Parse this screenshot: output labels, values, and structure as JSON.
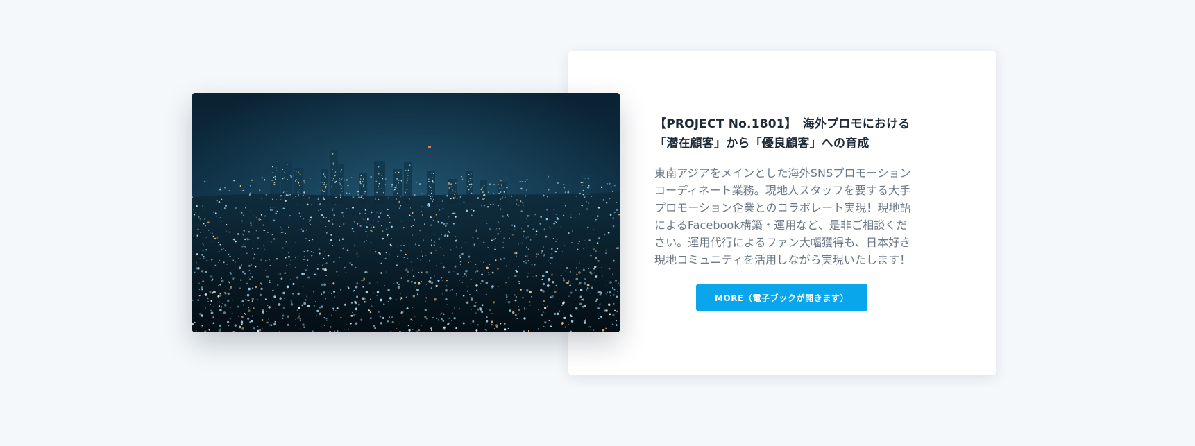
{
  "project": {
    "title": "【PROJECT No.1801】　海外プロモにおける\n「潜在顧客」から「優良顧客」への育成",
    "description": "東南アジアをメインとした海外SNSプロモーション\nコーディネート業務。現地人スタッフを要する大手\nプロモーション企業とのコラボレート実現！現地語\nによるFacebook構築・運用など、是非ご相談くだ\nさい。運用代行によるファン大幅獲得も、日本好き\n現地コミュニティを活用しながら実現いたします！",
    "more_button_label": "MORE（電子ブックが開きます）",
    "image": "night-city-skyline-photo"
  },
  "colors": {
    "page_background": "#f4f8fb",
    "card_background": "#ffffff",
    "title": "#1e2a36",
    "body_text": "#6c7886",
    "button": "#0aa6ec",
    "button_text": "#ffffff"
  }
}
